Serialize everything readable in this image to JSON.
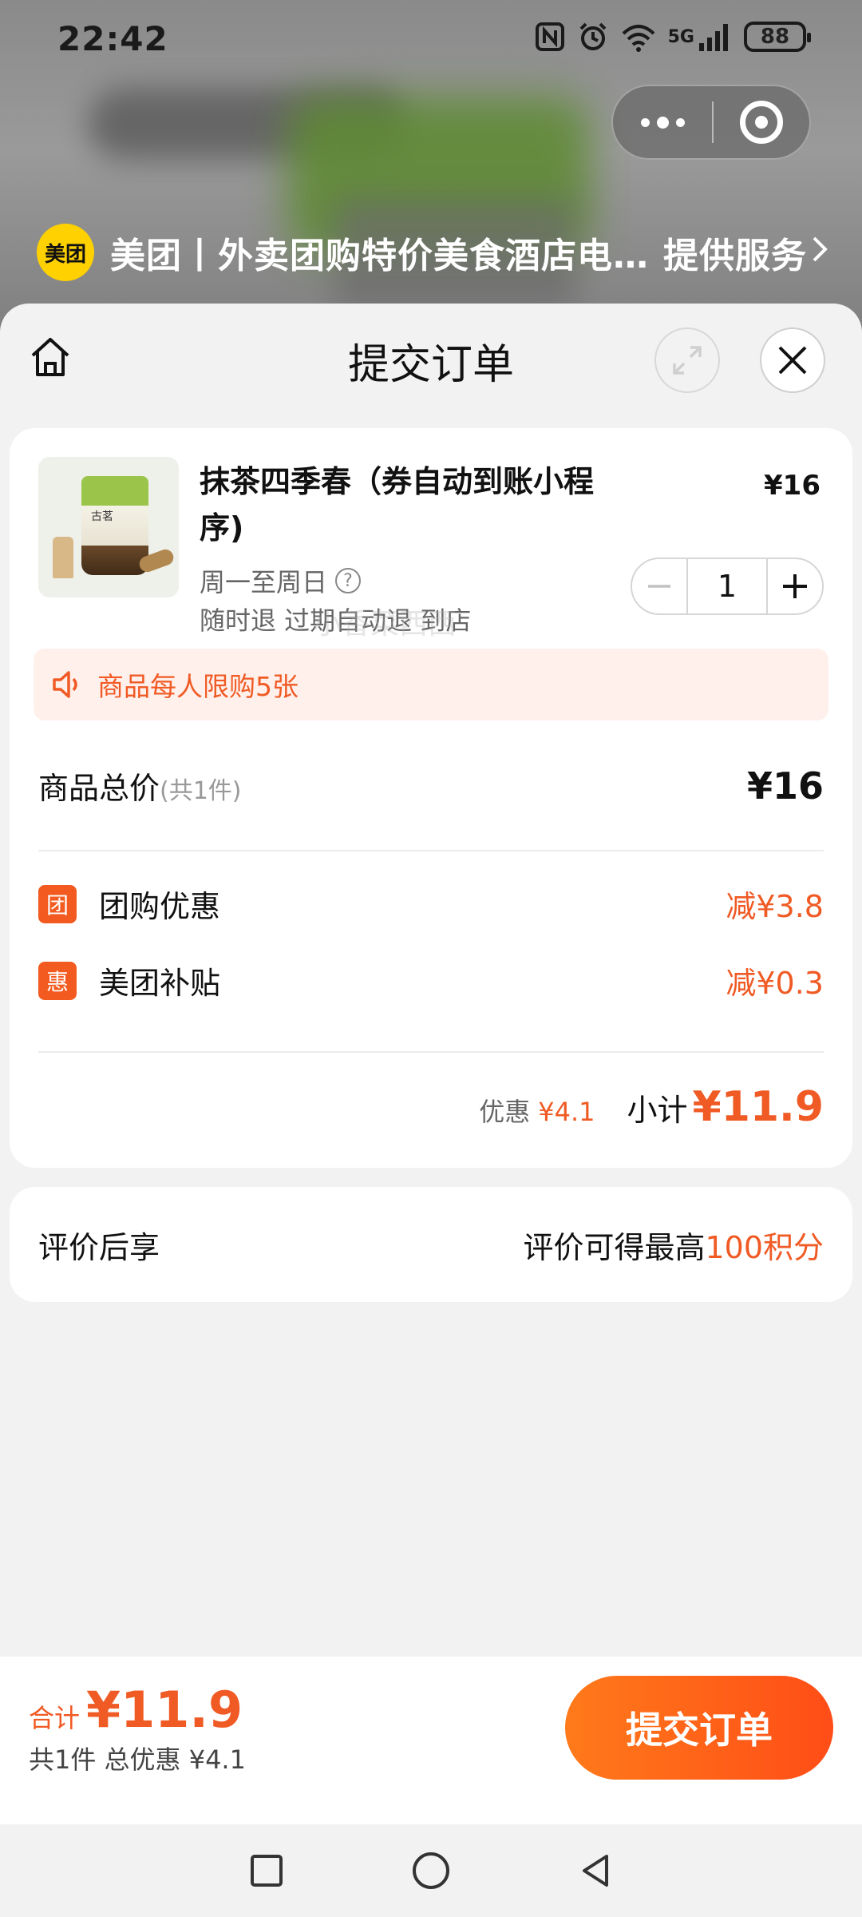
{
  "status_bar": {
    "time": "22:42",
    "icons": [
      "nfc-icon",
      "alarm-icon",
      "wifi-icon",
      "5g-signal-icon",
      "battery-icon"
    ],
    "signal_label": "5G",
    "battery": "88"
  },
  "provider": {
    "logo_text": "美团",
    "name": "美团丨外卖团购特价美食酒店电…",
    "service": "提供服务"
  },
  "sheet": {
    "title": "提交订单"
  },
  "order": {
    "product_name": "抹茶四季春（券自动到账小程序)",
    "price": "¥16",
    "days": "周一至周日",
    "refund": "随时退 过期自动退 到店",
    "quantity": "1",
    "thumb_label": "古茗",
    "notice": "商品每人限购5张",
    "total_label": "商品总价",
    "total_count": "(共1件)",
    "total_value": "¥16",
    "discounts": [
      {
        "badge": "团",
        "label": "团购优惠",
        "value": "减¥3.8"
      },
      {
        "badge": "惠",
        "label": "美团补贴",
        "value": "减¥0.3"
      }
    ],
    "watermark": "小香菜西西",
    "discount_sum_label": "优惠",
    "discount_sum_value": "¥4.1",
    "subtotal_label": "小计",
    "subtotal_value": "¥11.9"
  },
  "review": {
    "label": "评价后享",
    "text": "评价可得最高",
    "highlight": "100积分"
  },
  "bottom": {
    "sum_label": "合计",
    "sum_value": "¥11.9",
    "sum_sub": "共1件 总优惠 ¥4.1",
    "submit": "提交订单"
  },
  "colors": {
    "accent": "#f05a24",
    "button_start": "#ff7a1a",
    "button_end": "#ff4d17",
    "meituan_yellow": "#ffd100"
  }
}
